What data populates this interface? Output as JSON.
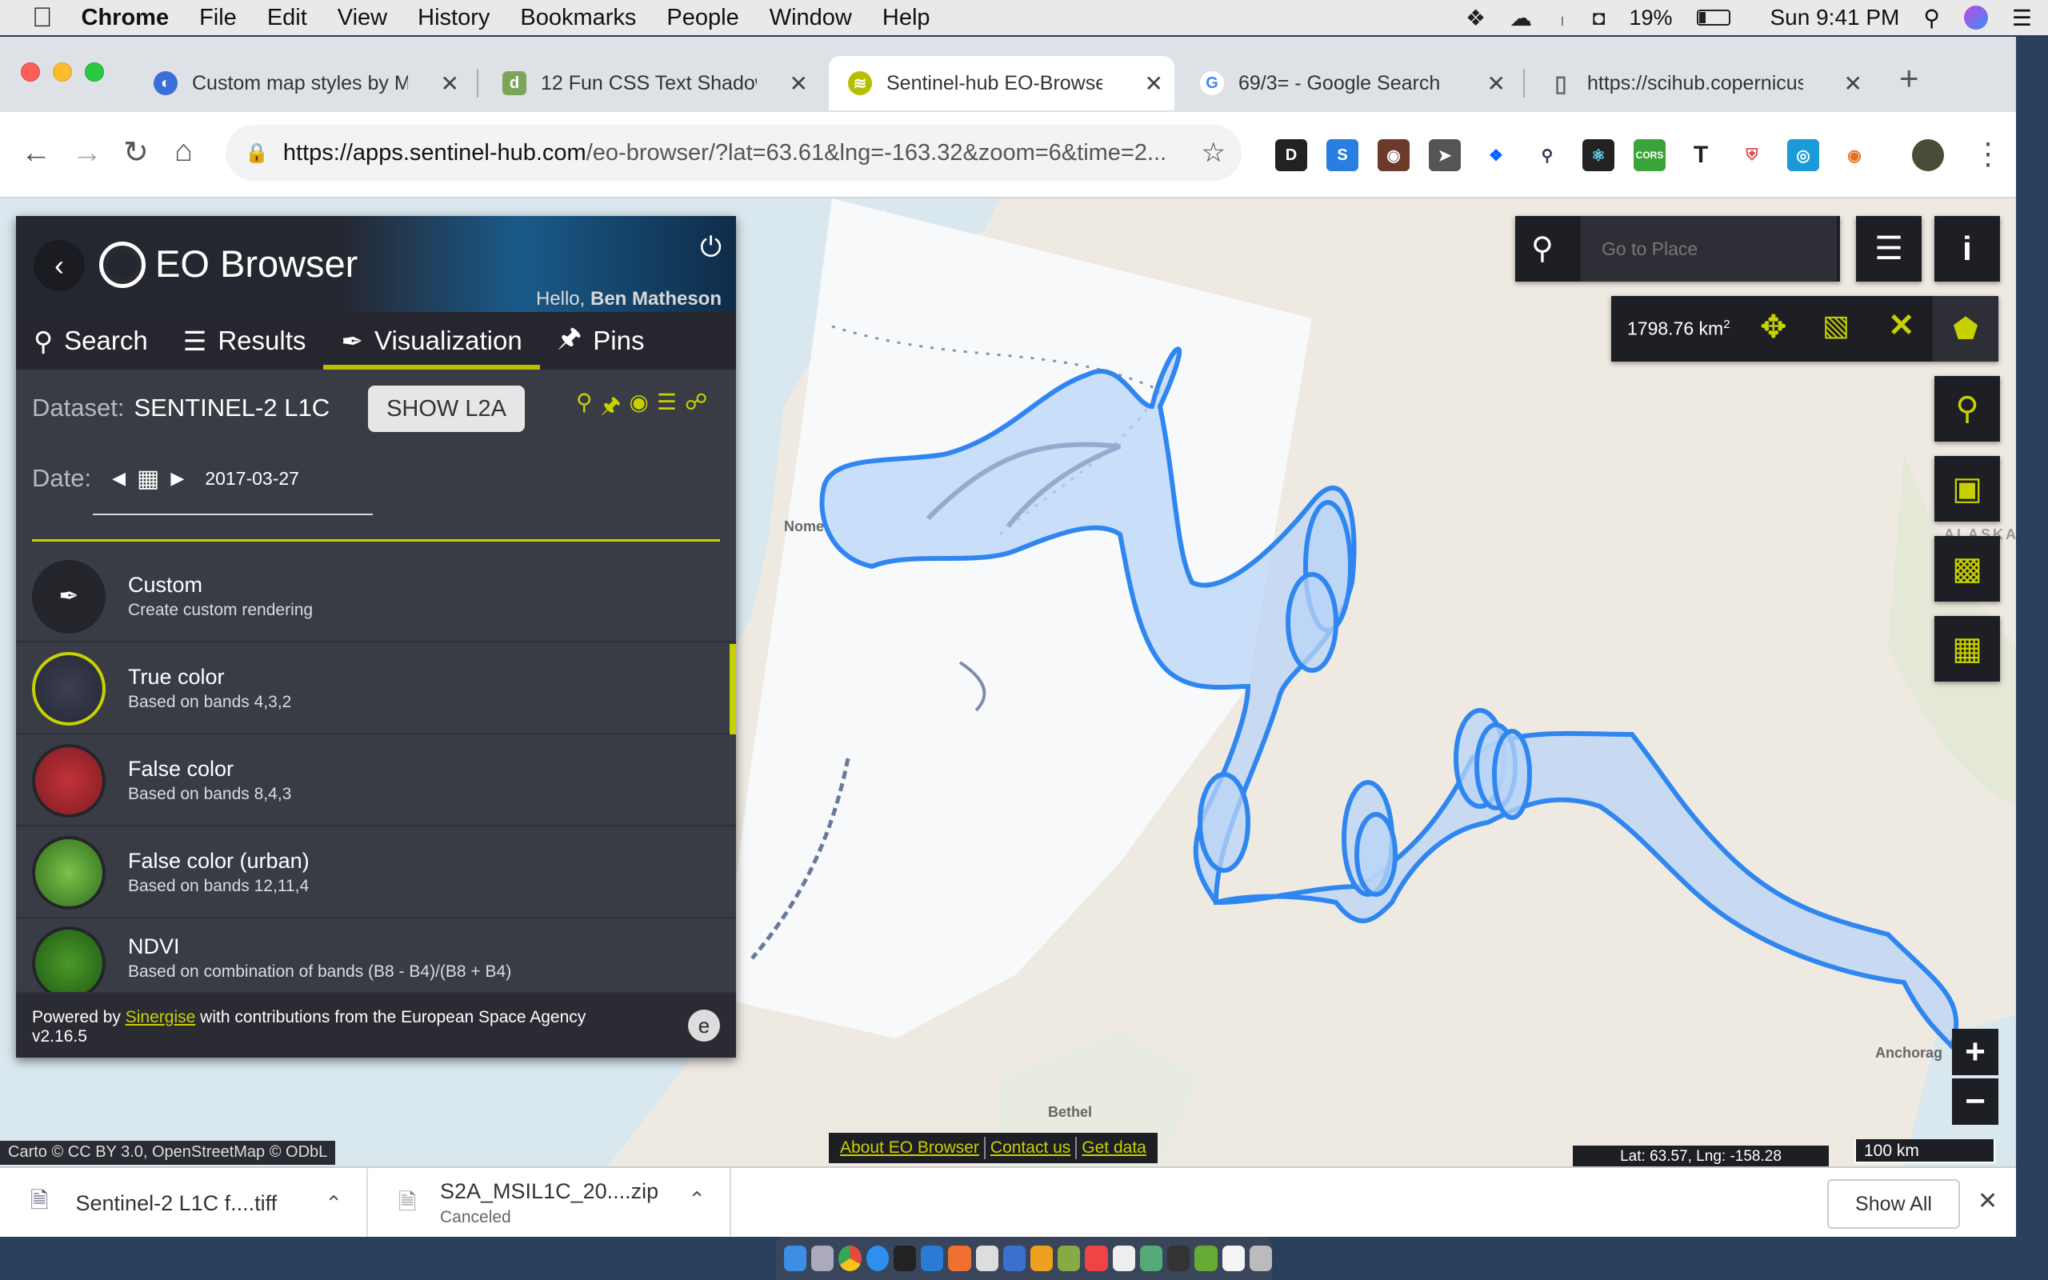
{
  "mac_menubar": {
    "apple": "",
    "app": "Chrome",
    "menus": [
      "File",
      "Edit",
      "View",
      "History",
      "Bookmarks",
      "People",
      "Window",
      "Help"
    ],
    "battery": "19%",
    "clock": "Sun 9:41 PM"
  },
  "tabs": [
    {
      "title": "Custom map styles by Mapl",
      "favicon_color": "#3b6fd8",
      "favicon_letter": "◐"
    },
    {
      "title": "12 Fun CSS Text Shadows Y",
      "favicon_color": "#7ba659",
      "favicon_letter": "d"
    },
    {
      "title": "Sentinel-hub EO-Browser",
      "favicon_color": "#b5bf00",
      "favicon_letter": "≋"
    },
    {
      "title": "69/3= - Google Search",
      "favicon_color": "#ffffff",
      "favicon_letter": "G"
    },
    {
      "title": "https://scihub.copernicus.e",
      "favicon_color": "#ffffff",
      "favicon_letter": "▯"
    }
  ],
  "new_tab": "+",
  "address": {
    "host": "https://apps.sentinel-hub.com",
    "path": "/eo-browser/?lat=63.61&lng=-163.32&zoom=6&time=2..."
  },
  "panel": {
    "app_title": "EO Browser",
    "greeting_prefix": "Hello,",
    "user_name": "Ben Matheson",
    "nav": [
      {
        "label": "Search",
        "icon": "search-icon"
      },
      {
        "label": "Results",
        "icon": "list-icon"
      },
      {
        "label": "Visualization",
        "icon": "brush-icon"
      },
      {
        "label": "Pins",
        "icon": "pin-icon"
      }
    ],
    "dataset_label": "Dataset:",
    "dataset_value": "SENTINEL-2 L1C",
    "show_l2a": "SHOW L2A",
    "date_label": "Date:",
    "date_value": "2017-03-27",
    "visualizations": [
      {
        "title": "Custom",
        "subtitle": "Create custom rendering",
        "thumb": "#2b2c33",
        "selected": false
      },
      {
        "title": "True color",
        "subtitle": "Based on bands 4,3,2",
        "thumb": "#323645",
        "selected": true
      },
      {
        "title": "False color",
        "subtitle": "Based on bands 8,4,3",
        "thumb": "#a8292e",
        "selected": false
      },
      {
        "title": "False color (urban)",
        "subtitle": "Based on bands 12,11,4",
        "thumb": "#4a9a2c",
        "selected": false
      },
      {
        "title": "NDVI",
        "subtitle": "Based on combination of bands (B8 - B4)/(B8 + B4)",
        "thumb": "#2f7a1e",
        "selected": false
      }
    ],
    "footer_prefix": "Powered by",
    "footer_link": "Sinergise",
    "footer_suffix": "with contributions from the European Space Agency",
    "version": "v2.16.5"
  },
  "map": {
    "search_placeholder": "Go to Place",
    "area_value": "1798.76 km",
    "area_sup": "2",
    "labels": {
      "nome": "Nome",
      "bethel": "Bethel",
      "anchorage": "Anchorag",
      "alaska": "ALASKA"
    },
    "zoom_in": "+",
    "zoom_out": "−",
    "attribution": "Carto © CC BY 3.0, OpenStreetMap © ODbL",
    "links": [
      "About EO Browser",
      "Contact us",
      "Get data"
    ],
    "coords": "Lat: 63.57, Lng: -158.28",
    "scale": "100 km"
  },
  "downloads": [
    {
      "name": "Sentinel-2 L1C f....tiff",
      "status": ""
    },
    {
      "name": "S2A_MSIL1C_20....zip",
      "status": "Canceled"
    }
  ],
  "show_all": "Show All",
  "colors": {
    "accent": "#c8d100",
    "poly_stroke": "#2f86f0",
    "poly_fill": "#b9d4f7"
  }
}
